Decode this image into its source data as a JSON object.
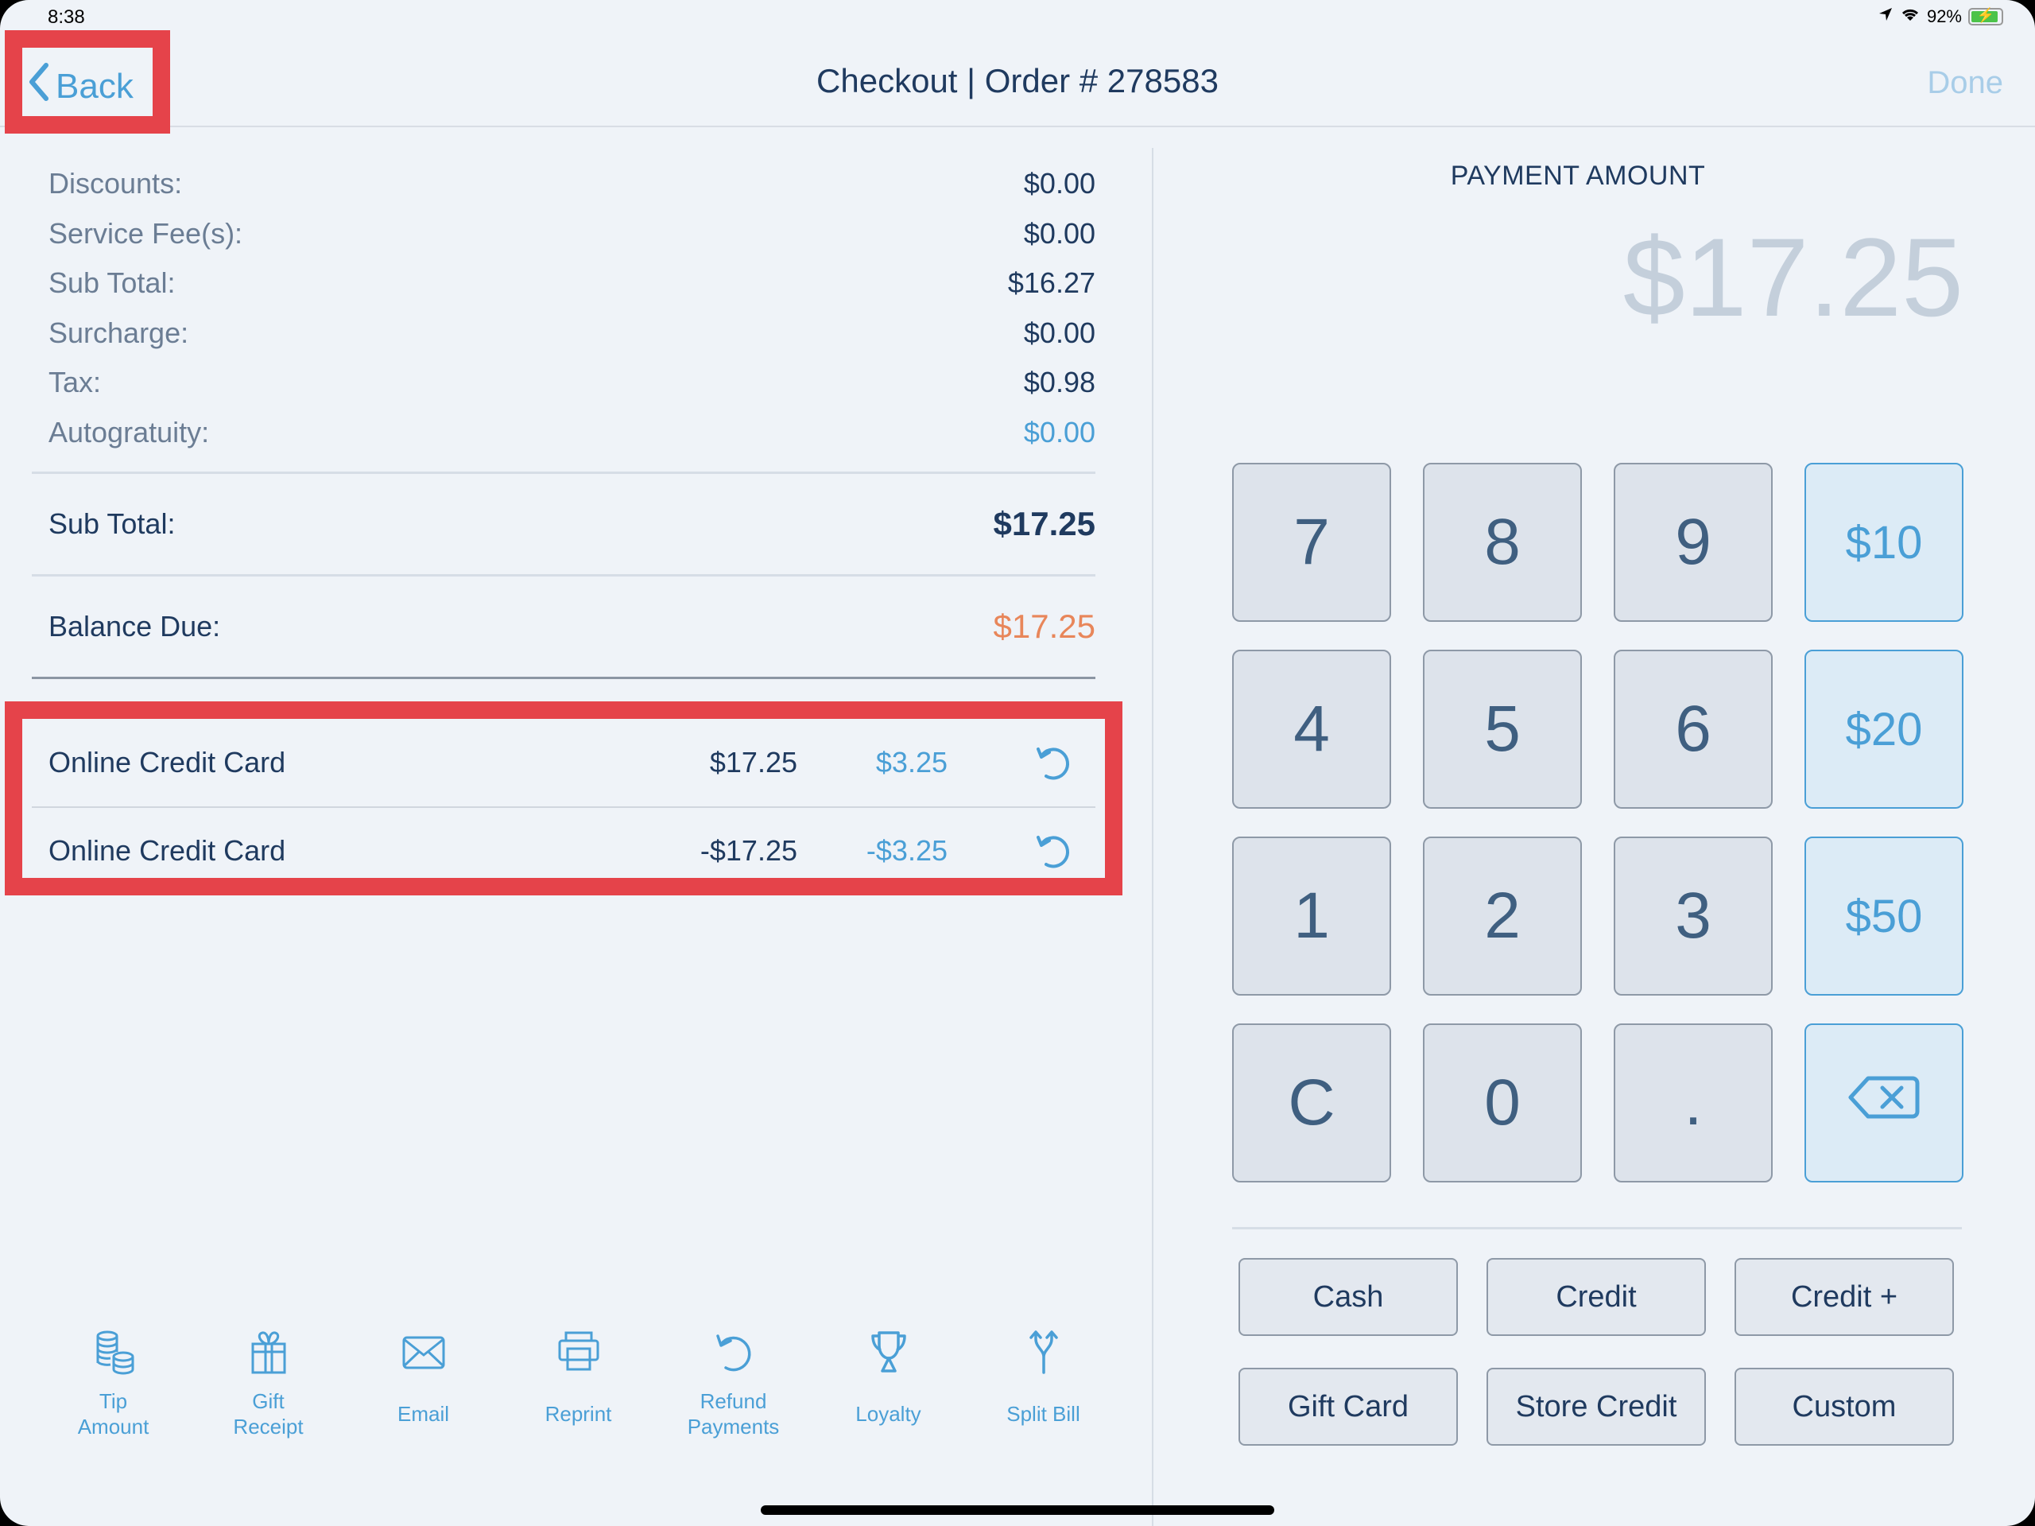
{
  "status_bar": {
    "time": "8:38",
    "battery_percent": "92%",
    "icons": [
      "location-arrow-icon",
      "wifi-icon",
      "battery-charging-icon"
    ]
  },
  "nav": {
    "back_label": "Back",
    "title": "Checkout | Order # 278583",
    "done_label": "Done"
  },
  "summary": {
    "rows": [
      {
        "label": "Discounts:",
        "value": "$0.00"
      },
      {
        "label": "Service Fee(s):",
        "value": "$0.00"
      },
      {
        "label": "Sub Total:",
        "value": "$16.27"
      },
      {
        "label": "Surcharge:",
        "value": "$0.00"
      },
      {
        "label": "Tax:",
        "value": "$0.98"
      },
      {
        "label": "Autogratuity:",
        "value": "$0.00"
      }
    ],
    "subtotal": {
      "label": "Sub Total:",
      "value": "$17.25"
    },
    "balance_due": {
      "label": "Balance Due:",
      "value": "$17.25"
    }
  },
  "payments": [
    {
      "method": "Online Credit Card",
      "amount": "$17.25",
      "tip": "$3.25",
      "action_icon": "refund-icon"
    },
    {
      "method": "Online Credit Card",
      "amount": "-$17.25",
      "tip": "-$3.25",
      "action_icon": "refund-icon"
    }
  ],
  "actions": [
    {
      "label": "Tip\nAmount",
      "icon": "coins-icon"
    },
    {
      "label": "Gift\nReceipt",
      "icon": "gift-icon"
    },
    {
      "label": "Email",
      "icon": "envelope-icon"
    },
    {
      "label": "Reprint",
      "icon": "printer-icon"
    },
    {
      "label": "Refund\nPayments",
      "icon": "refund-icon"
    },
    {
      "label": "Loyalty",
      "icon": "trophy-icon"
    },
    {
      "label": "Split Bill",
      "icon": "split-icon"
    }
  ],
  "payment_amount": {
    "title": "PAYMENT AMOUNT",
    "value": "$17.25"
  },
  "keypad": {
    "keys": [
      "7",
      "8",
      "9",
      "$10",
      "4",
      "5",
      "6",
      "$20",
      "1",
      "2",
      "3",
      "$50",
      "C",
      "0",
      ".",
      "backspace"
    ]
  },
  "payment_methods": [
    "Cash",
    "Credit",
    "Credit +",
    "Gift Card",
    "Store Credit",
    "Custom"
  ],
  "colors": {
    "accent": "#4a9fd6",
    "text_dark": "#1f3a5f",
    "balance_due": "#e8865a",
    "highlight": "#e5434a"
  }
}
